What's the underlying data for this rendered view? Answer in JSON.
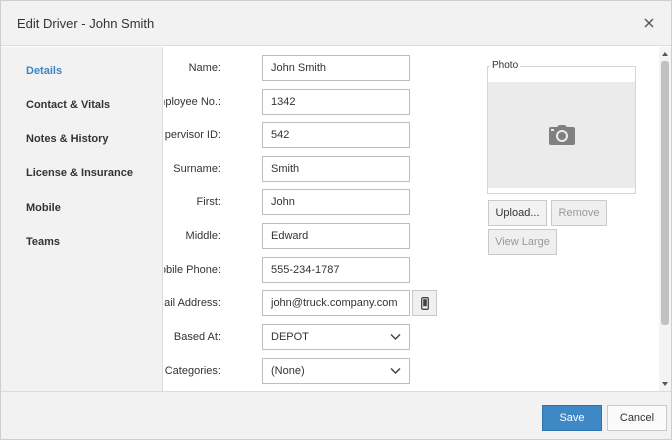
{
  "dialog": {
    "title": "Edit Driver - John Smith"
  },
  "sidebar": {
    "items": [
      {
        "label": "Details",
        "active": true
      },
      {
        "label": "Contact & Vitals"
      },
      {
        "label": "Notes & History"
      },
      {
        "label": "License & Insurance"
      },
      {
        "label": "Mobile"
      },
      {
        "label": "Teams"
      }
    ]
  },
  "form": {
    "name": {
      "label": "Name:",
      "value": "John Smith"
    },
    "employee_no": {
      "label": "Employee No.:",
      "value": "1342"
    },
    "supervisor_id": {
      "label": "Supervisor ID:",
      "value": "542"
    },
    "surname": {
      "label": "Surname:",
      "value": "Smith"
    },
    "first": {
      "label": "First:",
      "value": "John"
    },
    "middle": {
      "label": "Middle:",
      "value": "Edward"
    },
    "mobile_phone": {
      "label": "Mobile Phone:",
      "value": "555-234-1787"
    },
    "email": {
      "label": "Email Address:",
      "value": "john@truck.company.com"
    },
    "based_at": {
      "label": "Based At:",
      "value": "DEPOT"
    },
    "categories": {
      "label": "Categories:",
      "value": "(None)"
    }
  },
  "photo": {
    "legend": "Photo",
    "upload_label": "Upload...",
    "remove_label": "Remove",
    "view_large_label": "View Large"
  },
  "footer": {
    "save_label": "Save",
    "cancel_label": "Cancel"
  },
  "colors": {
    "accent": "#3e86c1",
    "save_button": "#3e88c6"
  },
  "icons": {
    "close": "close-icon",
    "mobile": "mobile-phone-icon",
    "camera": "camera-icon",
    "dropdown": "chevron-down-icon"
  }
}
